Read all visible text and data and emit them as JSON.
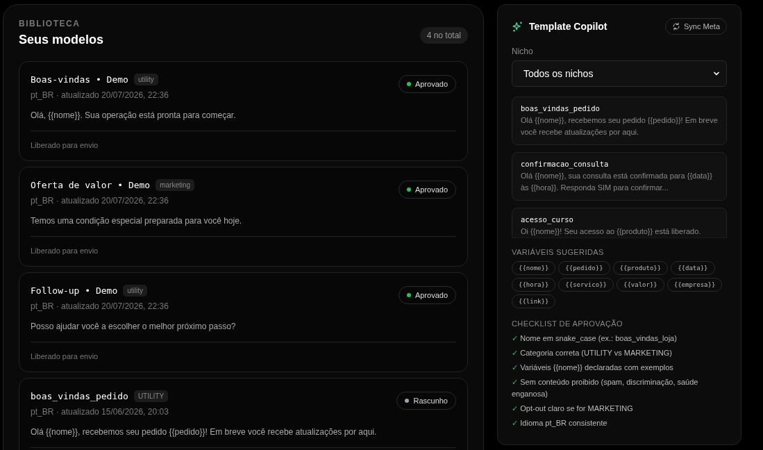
{
  "library": {
    "eyebrow": "BIBLIOTECA",
    "title": "Seus modelos",
    "count": "4 no total",
    "templates": [
      {
        "name": "Boas-vindas • Demo",
        "tag": "utility",
        "status": {
          "label": "Aprovado",
          "color": "#22c55e"
        },
        "meta": "pt_BR · atualizado 20/07/2026, 22:36",
        "body": "Olá, {{nome}}. Sua operação está pronta para começar.",
        "footer": "Liberado para envio"
      },
      {
        "name": "Oferta de valor • Demo",
        "tag": "marketing",
        "status": {
          "label": "Aprovado",
          "color": "#22c55e"
        },
        "meta": "pt_BR · atualizado 20/07/2026, 22:36",
        "body": "Temos uma condição especial preparada para você hoje.",
        "footer": "Liberado para envio"
      },
      {
        "name": "Follow-up • Demo",
        "tag": "utility",
        "status": {
          "label": "Aprovado",
          "color": "#22c55e"
        },
        "meta": "pt_BR · atualizado 20/07/2026, 22:36",
        "body": "Posso ajudar você a escolher o melhor próximo passo?",
        "footer": "Liberado para envio"
      },
      {
        "name": "boas_vindas_pedido",
        "tag": "UTILITY",
        "status": {
          "label": "Rascunho",
          "color": "#9ca3af"
        },
        "meta": "pt_BR · atualizado 15/06/2026, 20:03",
        "body": "Olá {{nome}}, recebemos seu pedido {{pedido}}! Em breve você recebe atualizações por aqui."
      }
    ]
  },
  "copilot": {
    "title": "Template Copilot",
    "sync_button": "Sync Meta",
    "niche_label": "Nicho",
    "niche_value": "Todos os nichos",
    "suggestions": [
      {
        "name": "boas_vindas_pedido",
        "text": "Olá {{nome}}, recebemos seu pedido {{pedido}}! Em breve você recebe atualizações por aqui."
      },
      {
        "name": "confirmacao_consulta",
        "text": "Olá {{nome}}, sua consulta está confirmada para {{data}} às {{hora}}. Responda SIM para confirmar..."
      },
      {
        "name": "acesso_curso",
        "text": "Oi {{nome}}! Seu acesso ao {{produto}} está liberado."
      }
    ],
    "variables_title": "VARIÁVEIS SUGERIDAS",
    "variables": [
      "{{nome}}",
      "{{pedido}}",
      "{{produto}}",
      "{{data}}",
      "{{hora}}",
      "{{servico}}",
      "{{valor}}",
      "{{empresa}}",
      "{{link}}"
    ],
    "checklist_title": "CHECKLIST DE APROVAÇÃO",
    "checklist": [
      {
        "mark": "✓",
        "text": "Nome em snake_case (ex.: boas_vindas_loja)"
      },
      {
        "mark": "✓",
        "text": "Categoria correta (UTILITY vs MARKETING)"
      },
      {
        "mark": "✓",
        "text": "Variáveis {{nome}} declaradas com exemplos"
      },
      {
        "mark": "✓",
        "text": "Sem conteúdo proibido (spam, discriminação, saúde enganosa)"
      },
      {
        "mark": "✓",
        "text": "Opt-out claro se for MARKETING"
      },
      {
        "mark": "✓",
        "text": "Idioma pt_BR consistente"
      }
    ]
  }
}
